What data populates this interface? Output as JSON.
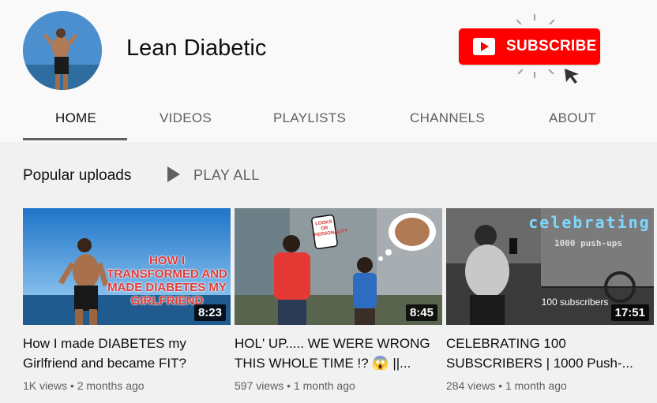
{
  "channel": {
    "name": "Lean Diabetic"
  },
  "subscribe": {
    "label": "SUBSCRIBE"
  },
  "tabs": [
    {
      "label": "HOME"
    },
    {
      "label": "VIDEOS"
    },
    {
      "label": "PLAYLISTS"
    },
    {
      "label": "CHANNELS"
    },
    {
      "label": "ABOUT"
    }
  ],
  "active_tab": "HOME",
  "section": {
    "title": "Popular uploads",
    "play_all": "PLAY ALL"
  },
  "videos": [
    {
      "title": "How I made DIABETES my Girlfriend and became FIT?",
      "duration": "8:23",
      "views": "1K views",
      "age": "2 months ago",
      "thumb_text": "HOW I TRANSFORMED AND MADE DIABETES MY GIRLFRIEND"
    },
    {
      "title": "HOL' UP..... WE WERE WRONG THIS WHOLE TIME !? 😱 ||...",
      "duration": "8:45",
      "views": "597 views",
      "age": "1 month ago",
      "thumb_text": "LOOKS OR PERSONALITY"
    },
    {
      "title": "CELEBRATING 100 SUBSCRIBERS | 1000 Push-...",
      "duration": "17:51",
      "views": "284 views",
      "age": "1 month ago",
      "thumb_text": "celebrating",
      "thumb_subtext": "1000 push-ups",
      "thumb_caption": "100 subscribers"
    }
  ],
  "colors": {
    "brand_red": "#ff0000",
    "text": "#0f0f0f",
    "muted": "#606060"
  }
}
